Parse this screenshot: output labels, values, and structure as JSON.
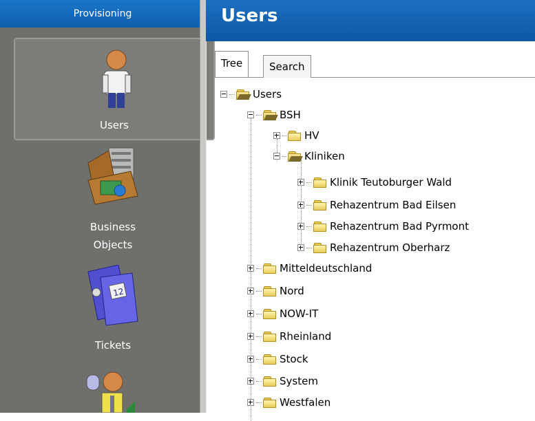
{
  "nav": {
    "header": "Provisioning",
    "items": [
      {
        "label": "Users",
        "icon": "user-icon",
        "selected": true
      },
      {
        "label": "Business\nObjects",
        "icon": "briefcase-icon"
      },
      {
        "label": "Tickets",
        "icon": "tickets-icon"
      },
      {
        "label": "",
        "icon": "roles-icon"
      }
    ]
  },
  "content": {
    "title": "Users",
    "tabs": [
      {
        "label": "Tree",
        "active": true
      },
      {
        "label": "Search",
        "active": false
      }
    ],
    "tree": [
      {
        "label": "Users",
        "level": 0,
        "expanded": true
      },
      {
        "label": "BSH",
        "level": 1,
        "expanded": true
      },
      {
        "label": "HV",
        "level": 2,
        "expanded": false
      },
      {
        "label": "Kliniken",
        "level": 2,
        "expanded": true
      },
      {
        "label": "Klinik Teutoburger Wald",
        "level": 3,
        "expanded": false
      },
      {
        "label": "Rehazentrum Bad Eilsen",
        "level": 3,
        "expanded": false
      },
      {
        "label": "Rehazentrum Bad Pyrmont",
        "level": 3,
        "expanded": false
      },
      {
        "label": "Rehazentrum Oberharz",
        "level": 3,
        "expanded": false
      },
      {
        "label": "Mitteldeutschland",
        "level": 1,
        "expanded": false
      },
      {
        "label": "Nord",
        "level": 1,
        "expanded": false
      },
      {
        "label": "NOW-IT",
        "level": 1,
        "expanded": false
      },
      {
        "label": "Rheinland",
        "level": 1,
        "expanded": false
      },
      {
        "label": "Stock",
        "level": 1,
        "expanded": false
      },
      {
        "label": "System",
        "level": 1,
        "expanded": false
      },
      {
        "label": "Westfalen",
        "level": 1,
        "expanded": false
      }
    ]
  },
  "colors": {
    "header_blue": "#0f5fae",
    "nav_background": "#6f6f6c"
  }
}
